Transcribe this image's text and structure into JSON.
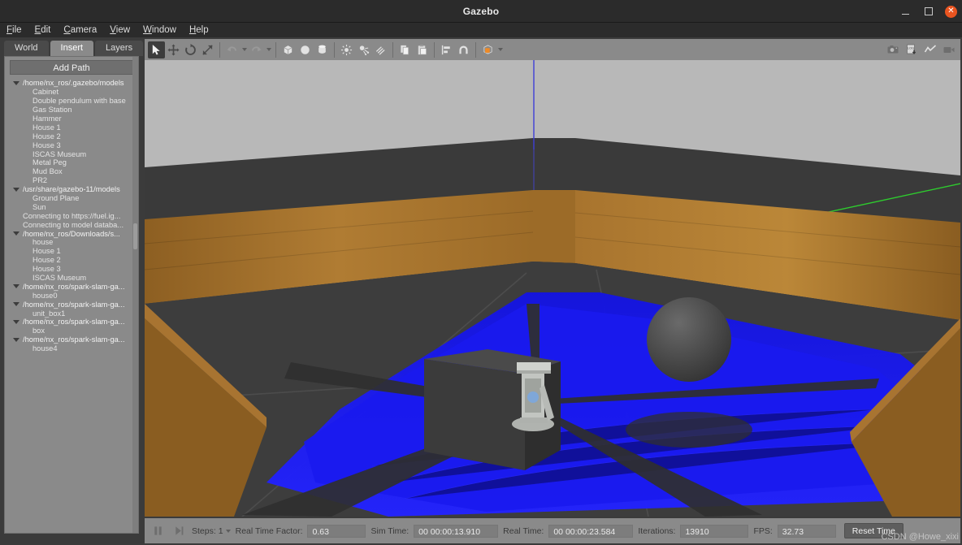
{
  "window": {
    "title": "Gazebo",
    "minimize_icon": "minimize-icon",
    "maximize_icon": "maximize-icon",
    "close_icon": "close-icon",
    "close_color": "#e95420"
  },
  "menubar": {
    "items": [
      {
        "label": "File",
        "mnemonic": "F",
        "rest": "ile"
      },
      {
        "label": "Edit",
        "mnemonic": "E",
        "rest": "dit"
      },
      {
        "label": "Camera",
        "mnemonic": "C",
        "rest": "amera"
      },
      {
        "label": "View",
        "mnemonic": "V",
        "rest": "iew"
      },
      {
        "label": "Window",
        "mnemonic": "W",
        "rest": "indow"
      },
      {
        "label": "Help",
        "mnemonic": "H",
        "rest": "elp"
      }
    ]
  },
  "left_panel": {
    "tabs": [
      {
        "label": "World",
        "active": false
      },
      {
        "label": "Insert",
        "active": true
      },
      {
        "label": "Layers",
        "active": false
      }
    ],
    "add_path_label": "Add Path",
    "tree": [
      {
        "type": "group",
        "label": "/home/nx_ros/.gazebo/models"
      },
      {
        "type": "child",
        "label": "Cabinet"
      },
      {
        "type": "child",
        "label": "Double pendulum with base"
      },
      {
        "type": "child",
        "label": "Gas Station"
      },
      {
        "type": "child",
        "label": "Hammer"
      },
      {
        "type": "child",
        "label": "House 1"
      },
      {
        "type": "child",
        "label": "House 2"
      },
      {
        "type": "child",
        "label": "House 3"
      },
      {
        "type": "child",
        "label": "ISCAS Museum"
      },
      {
        "type": "child",
        "label": "Metal Peg"
      },
      {
        "type": "child",
        "label": "Mud Box"
      },
      {
        "type": "child",
        "label": "PR2"
      },
      {
        "type": "group",
        "label": "/usr/share/gazebo-11/models"
      },
      {
        "type": "child",
        "label": "Ground Plane"
      },
      {
        "type": "child",
        "label": "Sun"
      },
      {
        "type": "plain",
        "label": "Connecting to https://fuel.ig..."
      },
      {
        "type": "plain",
        "label": "Connecting to model databa..."
      },
      {
        "type": "group",
        "label": "/home/nx_ros/Downloads/s..."
      },
      {
        "type": "child",
        "label": "house"
      },
      {
        "type": "child",
        "label": "House 1"
      },
      {
        "type": "child",
        "label": "House 2"
      },
      {
        "type": "child",
        "label": "House 3"
      },
      {
        "type": "child",
        "label": "ISCAS Museum"
      },
      {
        "type": "group",
        "label": "/home/nx_ros/spark-slam-ga..."
      },
      {
        "type": "child",
        "label": "house0"
      },
      {
        "type": "group",
        "label": "/home/nx_ros/spark-slam-ga..."
      },
      {
        "type": "child",
        "label": "unit_box1"
      },
      {
        "type": "group",
        "label": "/home/nx_ros/spark-slam-ga..."
      },
      {
        "type": "child",
        "label": "box"
      },
      {
        "type": "group",
        "label": "/home/nx_ros/spark-slam-ga..."
      },
      {
        "type": "child",
        "label": "house4"
      }
    ]
  },
  "toolbar": {
    "left_tools": [
      {
        "name": "select-arrow-icon",
        "selected": true
      },
      {
        "name": "translate-icon",
        "selected": false
      },
      {
        "name": "rotate-icon",
        "selected": false
      },
      {
        "name": "scale-icon",
        "selected": false
      },
      {
        "name": "undo-icon",
        "selected": false
      },
      {
        "name": "redo-icon",
        "selected": false
      },
      {
        "name": "box-icon",
        "selected": false
      },
      {
        "name": "sphere-icon",
        "selected": false
      },
      {
        "name": "cylinder-icon",
        "selected": false
      },
      {
        "name": "point-light-icon",
        "selected": false
      },
      {
        "name": "spot-light-icon",
        "selected": false
      },
      {
        "name": "directional-light-icon",
        "selected": false
      },
      {
        "name": "copy-icon",
        "selected": false
      },
      {
        "name": "paste-icon",
        "selected": false
      },
      {
        "name": "align-icon",
        "selected": false
      },
      {
        "name": "snap-icon",
        "selected": false
      },
      {
        "name": "view-angle-cube-icon",
        "selected": false
      }
    ],
    "accent_color": "#f08a24",
    "right_tools": [
      {
        "name": "screenshot-camera-icon"
      },
      {
        "name": "log-record-icon"
      },
      {
        "name": "plot-icon"
      },
      {
        "name": "video-record-icon"
      }
    ]
  },
  "statusbar": {
    "pause_icon": "pause-icon",
    "step_icon": "step-forward-icon",
    "steps_label": "Steps:",
    "steps_value": "1",
    "real_time_factor_label": "Real Time Factor:",
    "real_time_factor_value": "0.63",
    "sim_time_label": "Sim Time:",
    "sim_time_value": "00 00:00:13.910",
    "real_time_label": "Real Time:",
    "real_time_value": "00 00:00:23.584",
    "iterations_label": "Iterations:",
    "iterations_value": "13910",
    "fps_label": "FPS:",
    "fps_value": "32.73",
    "reset_time_label": "Reset Time"
  },
  "scene": {
    "sky_color": "#b8b8b8",
    "ground_color": "#3a3a3a",
    "wall_color": "#a8742e",
    "laser_color": "#1a1aee",
    "box_color": "#3f3f3f",
    "sphere_color": "#4a4a4a",
    "z_axis_color": "#3f3fd8",
    "y_axis_color": "#2ecc2e",
    "robot_color": "#b9bcb8"
  },
  "watermark": "CSDN @Howe_xixi"
}
